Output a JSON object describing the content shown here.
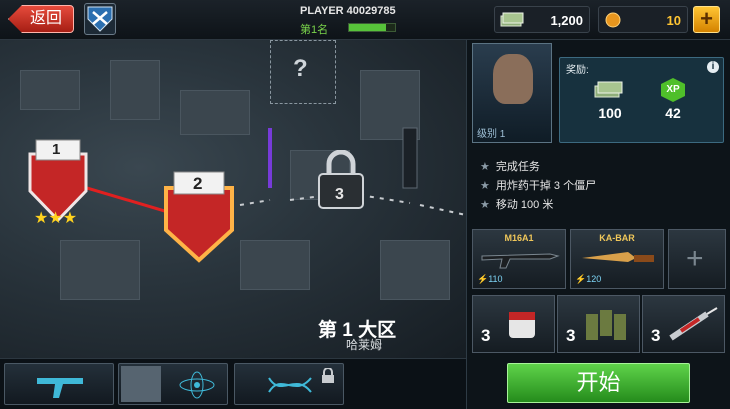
{
  "topbar": {
    "back_label": "返回",
    "player_name": "PLAYER 40029785",
    "rank_label": "第1名",
    "rank_progress": 0.8,
    "cash": "1,200",
    "coins": "10",
    "add_label": "+"
  },
  "map": {
    "mission_1": "1",
    "mission_2": "2",
    "locked_mission": "3",
    "mystery": "?",
    "district_title": "第 1 大区",
    "district_name": "哈莱姆"
  },
  "panel": {
    "portrait_level": "级别 1",
    "reward_title": "奖励:",
    "reward_cash": "100",
    "reward_xp_badge": "XP",
    "reward_xp": "42",
    "tasks": [
      "完成任务",
      "用炸药干掉 3 个僵尸",
      "移动 100 米"
    ],
    "weapons": [
      {
        "name": "M16A1",
        "value": "110"
      },
      {
        "name": "KA-BAR",
        "value": "120"
      }
    ],
    "add_weapon": "+",
    "items": [
      {
        "count": "3",
        "icon": "medkit-icon"
      },
      {
        "count": "3",
        "icon": "ammo-icon"
      },
      {
        "count": "3",
        "icon": "syringe-icon"
      }
    ],
    "start_label": "开始"
  },
  "colors": {
    "accent_green": "#57c33a",
    "back_red": "#c8322a",
    "gold": "#ffc533"
  }
}
